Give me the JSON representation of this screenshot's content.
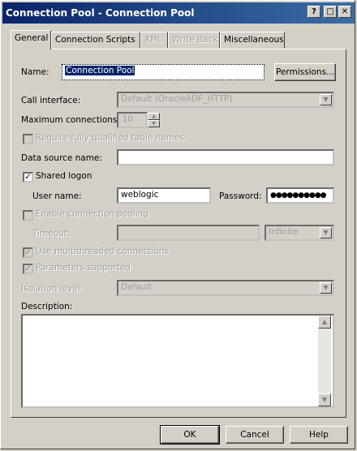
{
  "window": {
    "title": "Connection Pool - Connection Pool"
  },
  "titlebar_buttons": {
    "help": "?",
    "maximize": "□",
    "close": "✕"
  },
  "tabs": [
    {
      "label": "General",
      "active": true,
      "enabled": true
    },
    {
      "label": "Connection Scripts",
      "active": false,
      "enabled": true
    },
    {
      "label": "XML",
      "active": false,
      "enabled": false
    },
    {
      "label": "Write Back",
      "active": false,
      "enabled": false
    },
    {
      "label": "Miscellaneous",
      "active": false,
      "enabled": true
    }
  ],
  "general": {
    "name_label": "Name:",
    "name_value": "Connection Pool",
    "permissions_label": "Permissions...",
    "call_interface_label": "Call interface:",
    "call_interface_value": "Default (OracleADF_HTTP)",
    "max_connections_label": "Maximum connections:",
    "max_connections_value": "10",
    "require_qualified_label": "Require fully qualified table names",
    "data_source_label": "Data source name:",
    "data_source_value": "",
    "shared_logon_label": "Shared logon",
    "shared_logon_checked": true,
    "username_label": "User name:",
    "username_value": "weblogic",
    "password_label": "Password:",
    "password_value": "●●●●●●●●●●",
    "enable_pooling_label": "Enable connection pooling",
    "timeout_label": "Timeout:",
    "timeout_value": "",
    "timeout_unit_value": "Infinite",
    "multithreaded_label": "Use multithreaded connections",
    "parameters_supported_label": "Parameters supported",
    "isolation_label": "Isolation level:",
    "isolation_value": "Default",
    "description_label": "Description:",
    "description_value": ""
  },
  "footer": {
    "ok": "OK",
    "cancel": "Cancel",
    "help": "Help"
  },
  "colors": {
    "titlebar_start": "#0a246a",
    "titlebar_end": "#3a6ea5",
    "face": "#d4d0c8"
  }
}
